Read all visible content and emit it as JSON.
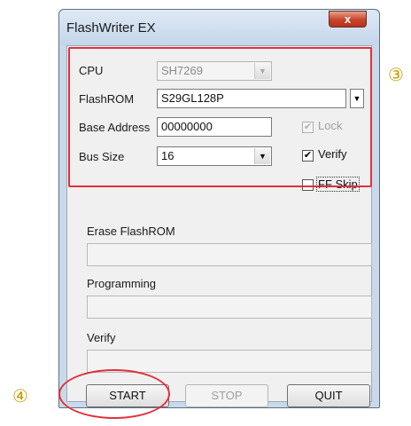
{
  "window": {
    "title": "FlashWriter EX",
    "close_glyph": "x"
  },
  "form": {
    "cpu": {
      "label": "CPU",
      "value": "SH7269"
    },
    "flashrom": {
      "label": "FlashROM",
      "value": "S29GL128P"
    },
    "base_address": {
      "label": "Base Address",
      "value": "00000000"
    },
    "bus_size": {
      "label": "Bus Size",
      "value": "16"
    },
    "lock": {
      "label": "Lock",
      "checked": true,
      "enabled": false
    },
    "verify_check": {
      "label": "Verify",
      "checked": true,
      "enabled": true
    },
    "ff_skip": {
      "label": "FF Skip",
      "checked": false,
      "enabled": true
    }
  },
  "progress": {
    "erase_label": "Erase FlashROM",
    "programming_label": "Programming",
    "verify_label": "Verify"
  },
  "buttons": {
    "start": "START",
    "stop": "STOP",
    "quit": "QUIT"
  },
  "annotations": {
    "marker_3": "③",
    "marker_4": "④",
    "color": "#e0313a"
  },
  "icons": {
    "dropdown": "▼",
    "check": "✔"
  }
}
